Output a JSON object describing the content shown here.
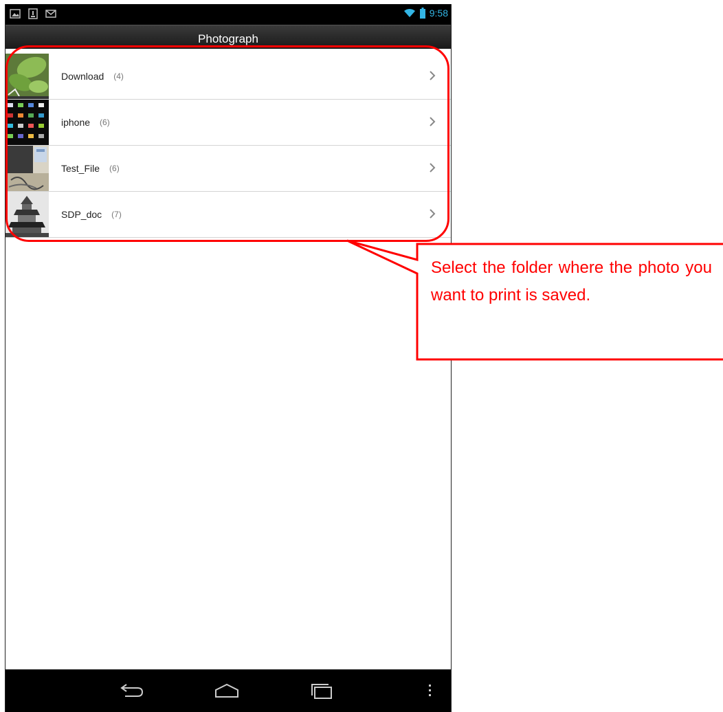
{
  "status_bar": {
    "time": "9:58",
    "left_icons": [
      "image-icon",
      "download-icon",
      "gmail-icon"
    ],
    "right_icons": [
      "wifi-icon",
      "battery-icon"
    ]
  },
  "action_bar": {
    "title": "Photograph"
  },
  "folders": [
    {
      "name": "Download",
      "count": "(4)",
      "thumb": "leaf-photo"
    },
    {
      "name": "iphone",
      "count": "(6)",
      "thumb": "screenshot-grid"
    },
    {
      "name": "Test_File",
      "count": "(6)",
      "thumb": "desk-photo"
    },
    {
      "name": "SDP_doc",
      "count": "(7)",
      "thumb": "castle-photo"
    }
  ],
  "nav_bar": {
    "buttons": [
      "back-icon",
      "home-icon",
      "recents-icon",
      "menu-icon"
    ]
  },
  "annotation": {
    "text": "Select the folder where the photo you want to print is saved.",
    "color": "#ff0000"
  },
  "colors": {
    "accent": "#33b5e5",
    "annotation": "#ff0000"
  }
}
